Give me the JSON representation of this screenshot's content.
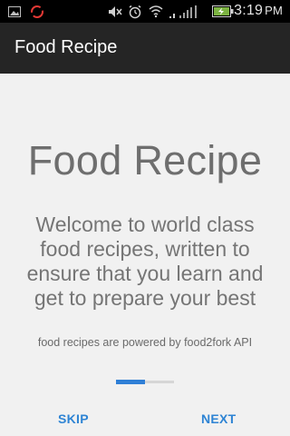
{
  "status_bar": {
    "time": "3:19",
    "time_suffix": "PM",
    "icons": [
      "image-icon",
      "sync-icon",
      "mute-icon",
      "alarm-icon",
      "wifi-icon",
      "signal-icon",
      "battery-charging-icon"
    ]
  },
  "action_bar": {
    "title": "Food Recipe"
  },
  "main": {
    "big_title": "Food Recipe",
    "welcome_text": "Welcome to world class food recipes, written to ensure that you learn and get to prepare your best",
    "powered_text": "food recipes are powered by food2fork API",
    "progress": 0.5
  },
  "buttons": {
    "skip": "SKIP",
    "next": "NEXT"
  },
  "colors": {
    "accent": "#2e84d4",
    "progress_fill": "#2f7fd6",
    "action_bar": "#252525",
    "background": "#f1f1f1"
  }
}
